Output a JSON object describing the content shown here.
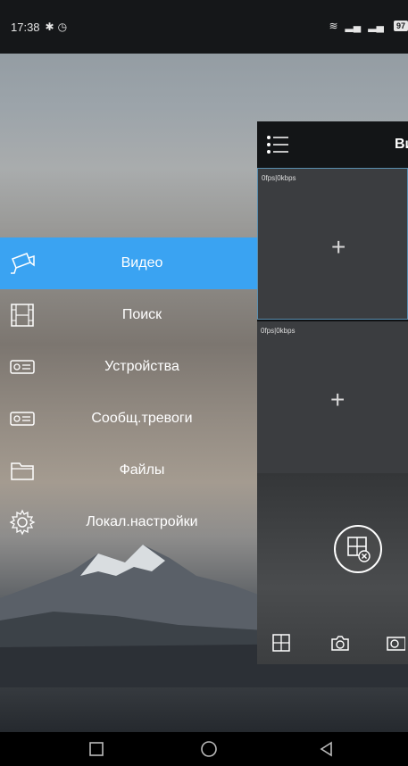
{
  "status_bar": {
    "time": "17:38",
    "bluetooth_icon": "bluetooth-icon",
    "alarm_icon": "alarm-icon",
    "signal_icons": [
      "wifi-icon",
      "signal-icon",
      "signal-icon"
    ],
    "battery": "97"
  },
  "menu": {
    "items": [
      {
        "label": "Видео",
        "icon": "camera-icon",
        "active": true
      },
      {
        "label": "Поиск",
        "icon": "film-icon",
        "active": false
      },
      {
        "label": "Устройства",
        "icon": "device-icon",
        "active": false
      },
      {
        "label": "Сообщ.тревоги",
        "icon": "device-icon",
        "active": false
      },
      {
        "label": "Файлы",
        "icon": "folder-icon",
        "active": false
      },
      {
        "label": "Локал.настройки",
        "icon": "gear-icon",
        "active": false
      }
    ],
    "active_color": "#3aa3f2"
  },
  "panel": {
    "title": "Ви",
    "cells": [
      {
        "stats": "0fps|0kbps"
      },
      {
        "stats": "0fps|0kbps"
      }
    ],
    "toolbar": [
      "grid-icon",
      "camera-icon",
      "record-icon"
    ]
  },
  "nav_bar": [
    "square-icon",
    "circle-icon",
    "back-icon"
  ]
}
